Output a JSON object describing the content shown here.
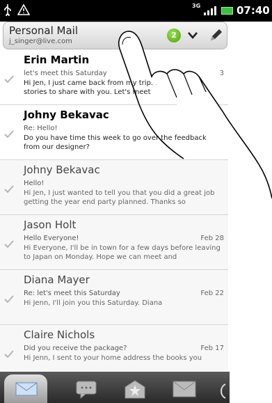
{
  "status_bar": {
    "network": "3G",
    "time": "07:40"
  },
  "account": {
    "name": "Personal Mail",
    "email": "j_singer@live.com",
    "unread_count": "2"
  },
  "emails": [
    {
      "from": "Erin Martin",
      "subject": "let's meet this Saturday",
      "date": "Feb 23",
      "preview": "Hi Jen, I just came back from my trip. I have lots of stories to share with you. Let's meet",
      "unread": true,
      "date_visible": "3"
    },
    {
      "from": "Johny Bekavac",
      "subject": "Re: Hello!",
      "date": "",
      "preview": "Do you have time this week to go over the feedback from our designer?",
      "unread": true,
      "date_visible": ""
    },
    {
      "from": "Johny Bekavac",
      "subject": "Hello!",
      "date": "",
      "preview": "Hi Jen, I just wanted to tell you that you did a great job getting the year end party planned. Thanks so",
      "unread": false,
      "date_visible": ""
    },
    {
      "from": "Jason Holt",
      "subject": "Hello Everyone!",
      "date": "Feb 28",
      "preview": "Hi Everyone, I'll be in town for a few days before leaving to Japan on Monday. Hope we can meet and",
      "unread": false,
      "date_visible": "Feb 28"
    },
    {
      "from": "Diana Mayer",
      "subject": "Re: let's meet this Saturday",
      "date": "Feb 22",
      "preview": "Hi Jenn,   I'll join you this Saturday.   Diana",
      "unread": false,
      "date_visible": "Feb 22"
    },
    {
      "from": "Claire Nichols",
      "subject": "Did you receive the package?",
      "date": "Feb 17",
      "preview": "Hi Jenn, I sent to your home address the books you",
      "unread": false,
      "date_visible": "Feb 17"
    }
  ],
  "tabs": [
    "inbox",
    "conversations",
    "favorites",
    "unread"
  ],
  "colors": {
    "badge": "#5db51b",
    "status_bar": "#000000"
  }
}
